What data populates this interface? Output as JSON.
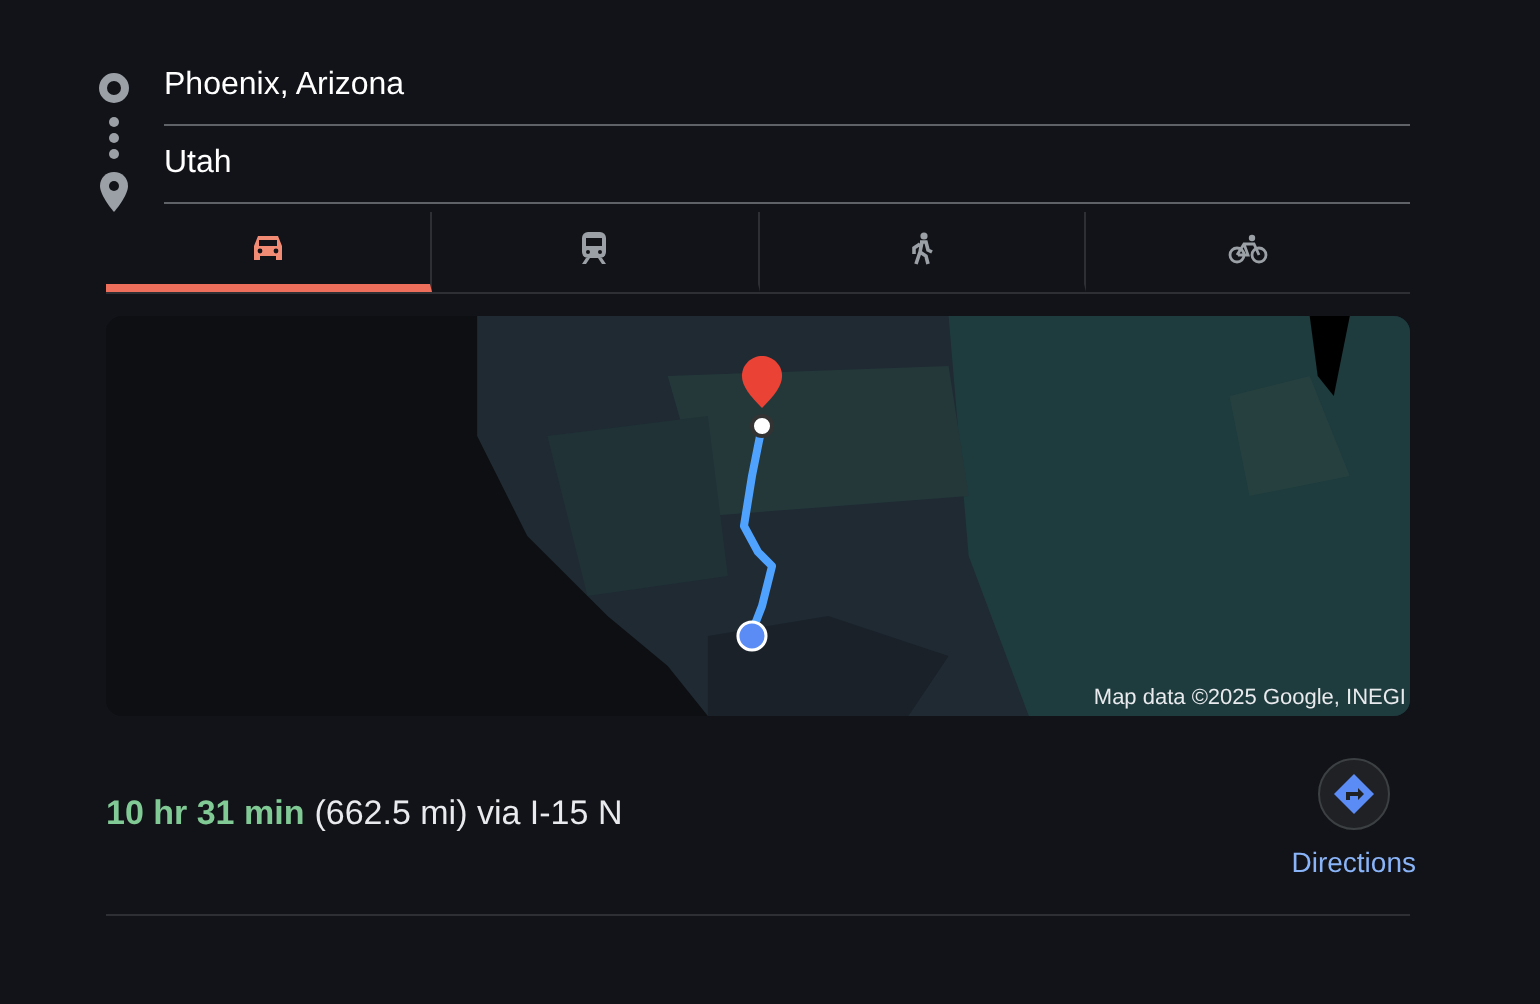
{
  "origin": {
    "value": "Phoenix, Arizona"
  },
  "destination": {
    "value": "Utah"
  },
  "modes": [
    {
      "kind": "car",
      "selected": true
    },
    {
      "kind": "transit",
      "selected": false
    },
    {
      "kind": "walk",
      "selected": false
    },
    {
      "kind": "bike",
      "selected": false
    }
  ],
  "map": {
    "kind": "picture",
    "attribution": "Map data ©2025 Google, INEGI"
  },
  "route": {
    "duration": "10 hr 31 min",
    "detail": "(662.5 mi) via I-15 N"
  },
  "directions_button": {
    "label": "Directions"
  }
}
